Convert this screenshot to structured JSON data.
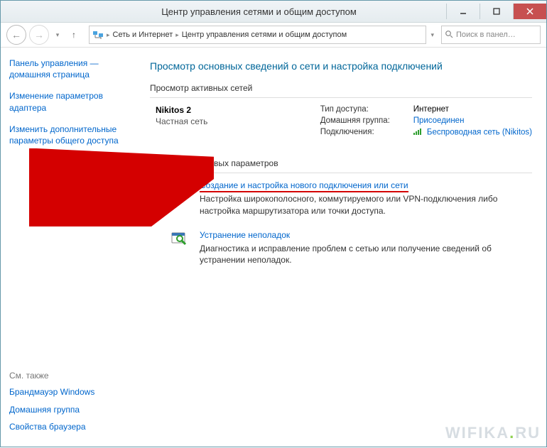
{
  "window": {
    "title": "Центр управления сетями и общим доступом"
  },
  "toolbar": {
    "breadcrumb": {
      "part1": "Сеть и Интернет",
      "part2": "Центр управления сетями и общим доступом"
    },
    "search_placeholder": "Поиск в панел…"
  },
  "sidebar": {
    "links": [
      "Панель управления — домашняя страница",
      "Изменение параметров адаптера",
      "Изменить дополнительные параметры общего доступа"
    ],
    "see_also_label": "См. также",
    "see_also": [
      "Брандмауэр Windows",
      "Домашняя группа",
      "Свойства браузера"
    ]
  },
  "main": {
    "heading": "Просмотр основных сведений о сети и настройка подключений",
    "active_networks_title": "Просмотр активных сетей",
    "network": {
      "name": "Nikitos 2",
      "type": "Частная сеть",
      "props": {
        "access_label": "Тип доступа:",
        "access_value": "Интернет",
        "homegroup_label": "Домашняя группа:",
        "homegroup_value": "Присоединен",
        "connections_label": "Подключения:",
        "connections_value": "Беспроводная сеть (Nikitos)"
      }
    },
    "change_settings_title": "Изменение сетевых параметров",
    "option1": {
      "link": "Создание и настройка нового подключения или сети",
      "desc": "Настройка широкополосного, коммутируемого или VPN-подключения либо настройка маршрутизатора или точки доступа."
    },
    "option2": {
      "link": "Устранение неполадок",
      "desc": "Диагностика и исправление проблем с сетью или получение сведений об устранении неполадок."
    }
  },
  "watermark": {
    "left": "WIFIKA",
    "right": "RU"
  }
}
